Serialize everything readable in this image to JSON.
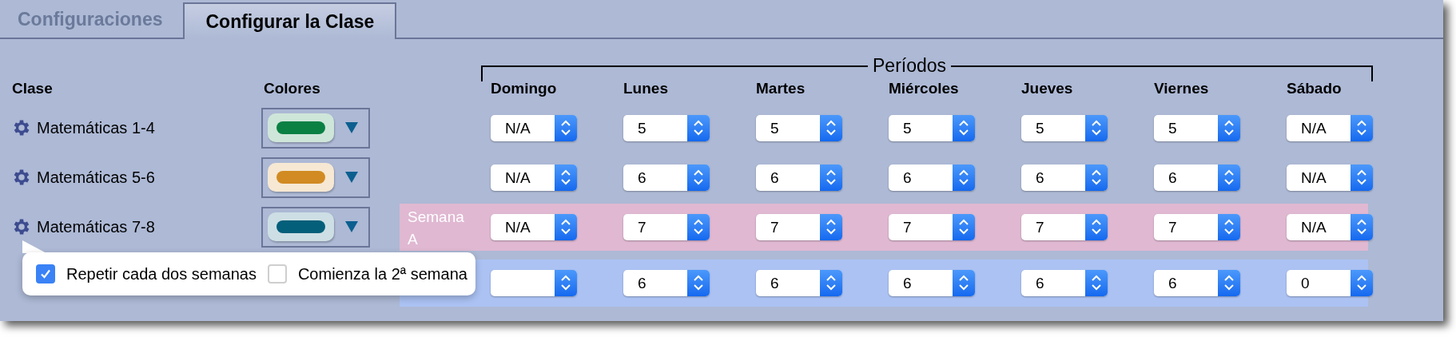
{
  "tabs": [
    {
      "label": "Configuraciones",
      "selected": false
    },
    {
      "label": "Configurar la Clase",
      "selected": true
    }
  ],
  "headers": {
    "class": "Clase",
    "colors": "Colores",
    "periods": "Períodos",
    "days": [
      "Domingo",
      "Lunes",
      "Martes",
      "Miércoles",
      "Jueves",
      "Viernes",
      "Sábado"
    ]
  },
  "rows": [
    {
      "class_name": "Matemáticas 1-4",
      "swatch": {
        "color": "#0a8043"
      },
      "periods": [
        "N/A",
        "5",
        "5",
        "5",
        "5",
        "5",
        "N/A"
      ]
    },
    {
      "class_name": "Matemáticas 5-6",
      "swatch": {
        "color": "#d18b22"
      },
      "periods": [
        "N/A",
        "6",
        "6",
        "6",
        "6",
        "6",
        "N/A"
      ]
    },
    {
      "class_name": "Matemáticas 7-8",
      "swatch": {
        "color": "#045f7a"
      },
      "week": {
        "label": [
          "Semana",
          "A"
        ],
        "color": "#e0b8d2"
      },
      "periods": [
        "N/A",
        "7",
        "7",
        "7",
        "7",
        "7",
        "N/A"
      ]
    },
    {
      "week": {
        "color": "#abc2f3"
      },
      "periods": [
        "6",
        "6",
        "6",
        "6",
        "6",
        "0"
      ]
    }
  ],
  "popup": {
    "options": [
      {
        "label": "Repetir cada dos semanas",
        "checked": true
      },
      {
        "label": "Comienza la 2ª semana",
        "checked": false
      }
    ]
  }
}
